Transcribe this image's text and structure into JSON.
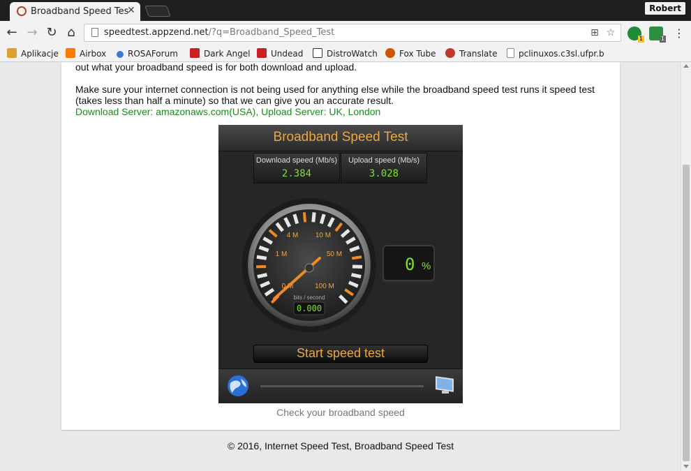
{
  "browser": {
    "tab_title": "Broadband Speed Test",
    "profile_name": "Robert",
    "url_host": "speedtest.appzend.net",
    "url_path": "/?q=Broadband_Speed_Test",
    "extension_badge_1": "1",
    "extension_badge_2": "1"
  },
  "bookmarks": [
    {
      "label": "Aplikacje",
      "color": "#e0a030"
    },
    {
      "label": "Airbox",
      "color": "#ff7a00"
    },
    {
      "label": "ROSAForum",
      "color": "#3a7bd5"
    },
    {
      "label": "Dark Angel",
      "color": "#cc1f1f"
    },
    {
      "label": "Undead",
      "color": "#cc1f1f"
    },
    {
      "label": "DistroWatch",
      "color": "#333333"
    },
    {
      "label": "Fox Tube",
      "color": "#d35400"
    },
    {
      "label": "Translate",
      "color": "#c0392b"
    },
    {
      "label": "pclinuxos.c3sl.ufpr.b",
      "color": "#888888"
    }
  ],
  "page": {
    "intro_tail": "out what your broadband speed is for both download and upload.",
    "instructions": "Make sure your internet connection is not being used for anything else while the broadband speed test runs it speed test (takes less than half a minute) so that we can give you an accurate result.",
    "servers": "Download Server: amazonaws.com(USA), Upload Server: UK, London",
    "caption": "Check your broadband speed",
    "footer": "© 2016, Internet Speed Test, Broadband Speed Test"
  },
  "widget": {
    "title": "Broadband Speed Test",
    "download_label": "Download speed (Mb/s)",
    "download_value": "2.384",
    "upload_label": "Upload speed (Mb/s)",
    "upload_value": "3.028",
    "gauge_labels": [
      "0 M",
      "1 M",
      "4 M",
      "10 M",
      "50 M",
      "100 M"
    ],
    "gauge_unit": "bits / second",
    "gauge_readout": "0.000",
    "progress_value": "0",
    "progress_unit": "%",
    "progress_fraction": 0,
    "start_label": "Start speed test",
    "accent_color": "#e8a847",
    "digit_color": "#7fe02a"
  }
}
